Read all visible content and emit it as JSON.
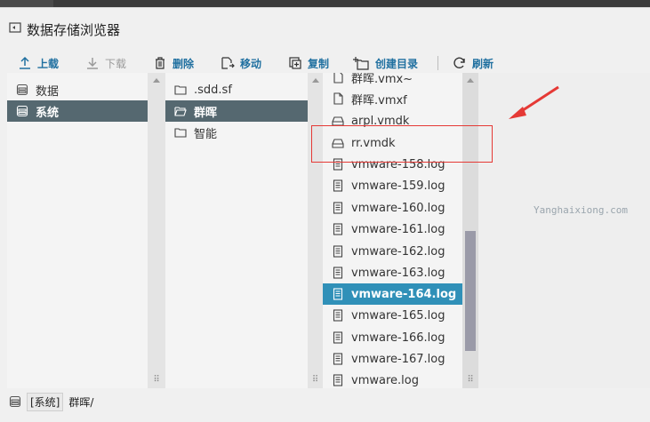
{
  "window": {
    "title": "数据存储浏览器"
  },
  "toolbar": {
    "upload": "上载",
    "download": "下载",
    "delete": "删除",
    "move": "移动",
    "copy": "复制",
    "create_dir": "创建目录",
    "refresh": "刷新"
  },
  "pane1": {
    "items": [
      {
        "label": "数据"
      },
      {
        "label": "系统"
      }
    ]
  },
  "pane2": {
    "items": [
      {
        "label": ".sdd.sf"
      },
      {
        "label": "群晖"
      },
      {
        "label": "智能"
      }
    ]
  },
  "pane3": {
    "items": [
      {
        "label": "群晖.vmx~"
      },
      {
        "label": "群晖.vmxf"
      },
      {
        "label": "arpl.vmdk"
      },
      {
        "label": "rr.vmdk"
      },
      {
        "label": "vmware-158.log"
      },
      {
        "label": "vmware-159.log"
      },
      {
        "label": "vmware-160.log"
      },
      {
        "label": "vmware-161.log"
      },
      {
        "label": "vmware-162.log"
      },
      {
        "label": "vmware-163.log"
      },
      {
        "label": "vmware-164.log"
      },
      {
        "label": "vmware-165.log"
      },
      {
        "label": "vmware-166.log"
      },
      {
        "label": "vmware-167.log"
      },
      {
        "label": "vmware.log"
      }
    ]
  },
  "watermark": "Yanghaixiong.com",
  "status": {
    "datastore": "[系统]",
    "path": "群晖/"
  },
  "colors": {
    "accent": "#2070a0",
    "selected_dark": "#556870",
    "selected_blue": "#3090b8",
    "annotation_red": "#e53935"
  }
}
